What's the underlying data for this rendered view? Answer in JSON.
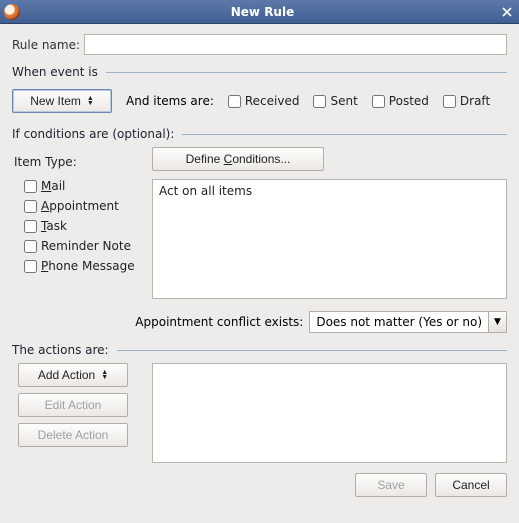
{
  "window": {
    "title": "New Rule"
  },
  "rule_name": {
    "label": "Rule name:",
    "value": ""
  },
  "when_event": {
    "heading": "When event is",
    "new_item_label": "New Item",
    "items_are_label": "And items are:",
    "checks": {
      "received": "Received",
      "sent": "Sent",
      "posted": "Posted",
      "draft": "Draft"
    }
  },
  "conditions": {
    "heading": "If conditions are  (optional):",
    "item_type_label": "Item Type:",
    "define_label_pre": "Define ",
    "define_label_ul": "C",
    "define_label_post": "onditions...",
    "summary": "Act on all items",
    "types": {
      "mail_pre": "",
      "mail_ul": "M",
      "mail_post": "ail",
      "appt_pre": "",
      "appt_ul": "A",
      "appt_post": "ppointment",
      "task_pre": "",
      "task_ul": "T",
      "task_post": "ask",
      "reminder": "Reminder Note",
      "phone_pre": "",
      "phone_ul": "P",
      "phone_post": "hone Message"
    },
    "conflict_label": "Appointment conflict exists:",
    "conflict_value": "Does not matter (Yes or no)"
  },
  "actions": {
    "heading": "The actions are:",
    "add_label": "Add Action",
    "edit_label": "Edit Action",
    "delete_label": "Delete Action"
  },
  "footer": {
    "save": "Save",
    "cancel": "Cancel"
  }
}
